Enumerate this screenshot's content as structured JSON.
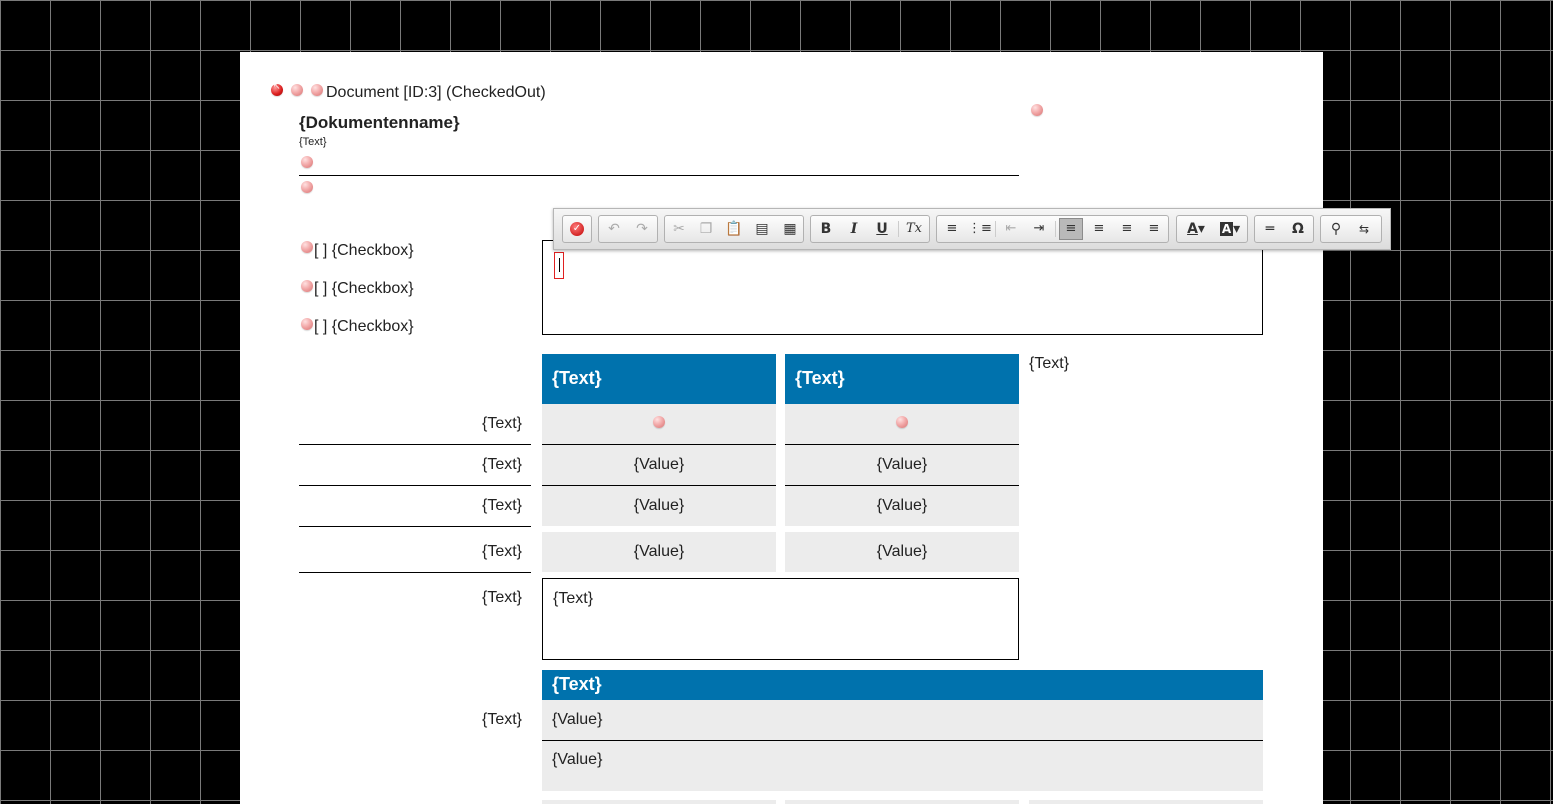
{
  "header": {
    "title": "Document [ID:3] (CheckedOut)",
    "doc_name": "{Dokumentenname}",
    "small_text": "{Text}"
  },
  "checkboxes": [
    {
      "label": "[ ] {Checkbox}"
    },
    {
      "label": "[ ] {Checkbox}"
    },
    {
      "label": "[ ] {Checkbox}"
    }
  ],
  "toolbar": {
    "buttons": [
      "spellcheck-icon",
      "undo-icon",
      "redo-icon",
      "cut-icon",
      "copy-icon",
      "paste-icon",
      "paste-text-icon",
      "paste-word-icon",
      "bold-icon",
      "italic-icon",
      "underline-icon",
      "remove-format-icon",
      "numbered-list-icon",
      "bulleted-list-icon",
      "decrease-indent-icon",
      "increase-indent-icon",
      "align-left-icon",
      "align-center-icon",
      "align-right-icon",
      "justify-icon",
      "text-color-icon",
      "background-color-icon",
      "horizontal-line-icon",
      "special-char-icon",
      "find-icon",
      "replace-icon"
    ],
    "glyphs": {
      "bold": "B",
      "italic": "I",
      "underline": "U",
      "remove_format": "Tx",
      "text_color": "A",
      "bg_color": "A",
      "omega": "Ω"
    }
  },
  "table1": {
    "col_headers": [
      "{Text}",
      "{Text}"
    ],
    "side_text": "{Text}",
    "rows": [
      {
        "label": "{Text}",
        "cells": [
          "",
          ""
        ],
        "dots": true
      },
      {
        "label": "{Text}",
        "cells": [
          "{Value}",
          "{Value}"
        ]
      },
      {
        "label": "{Text}",
        "cells": [
          "{Value}",
          "{Value}"
        ]
      },
      {
        "label": "{Text}",
        "cells": [
          "{Value}",
          "{Value}"
        ]
      }
    ]
  },
  "textarea_row": {
    "label": "{Text}",
    "content": "{Text}"
  },
  "table2": {
    "label": "{Text}",
    "header": "{Text}",
    "values": [
      "{Value}",
      "{Value}"
    ]
  },
  "colors": {
    "accent_blue": "#0072ad",
    "cell_gray": "#ececec",
    "background": "#000000"
  }
}
